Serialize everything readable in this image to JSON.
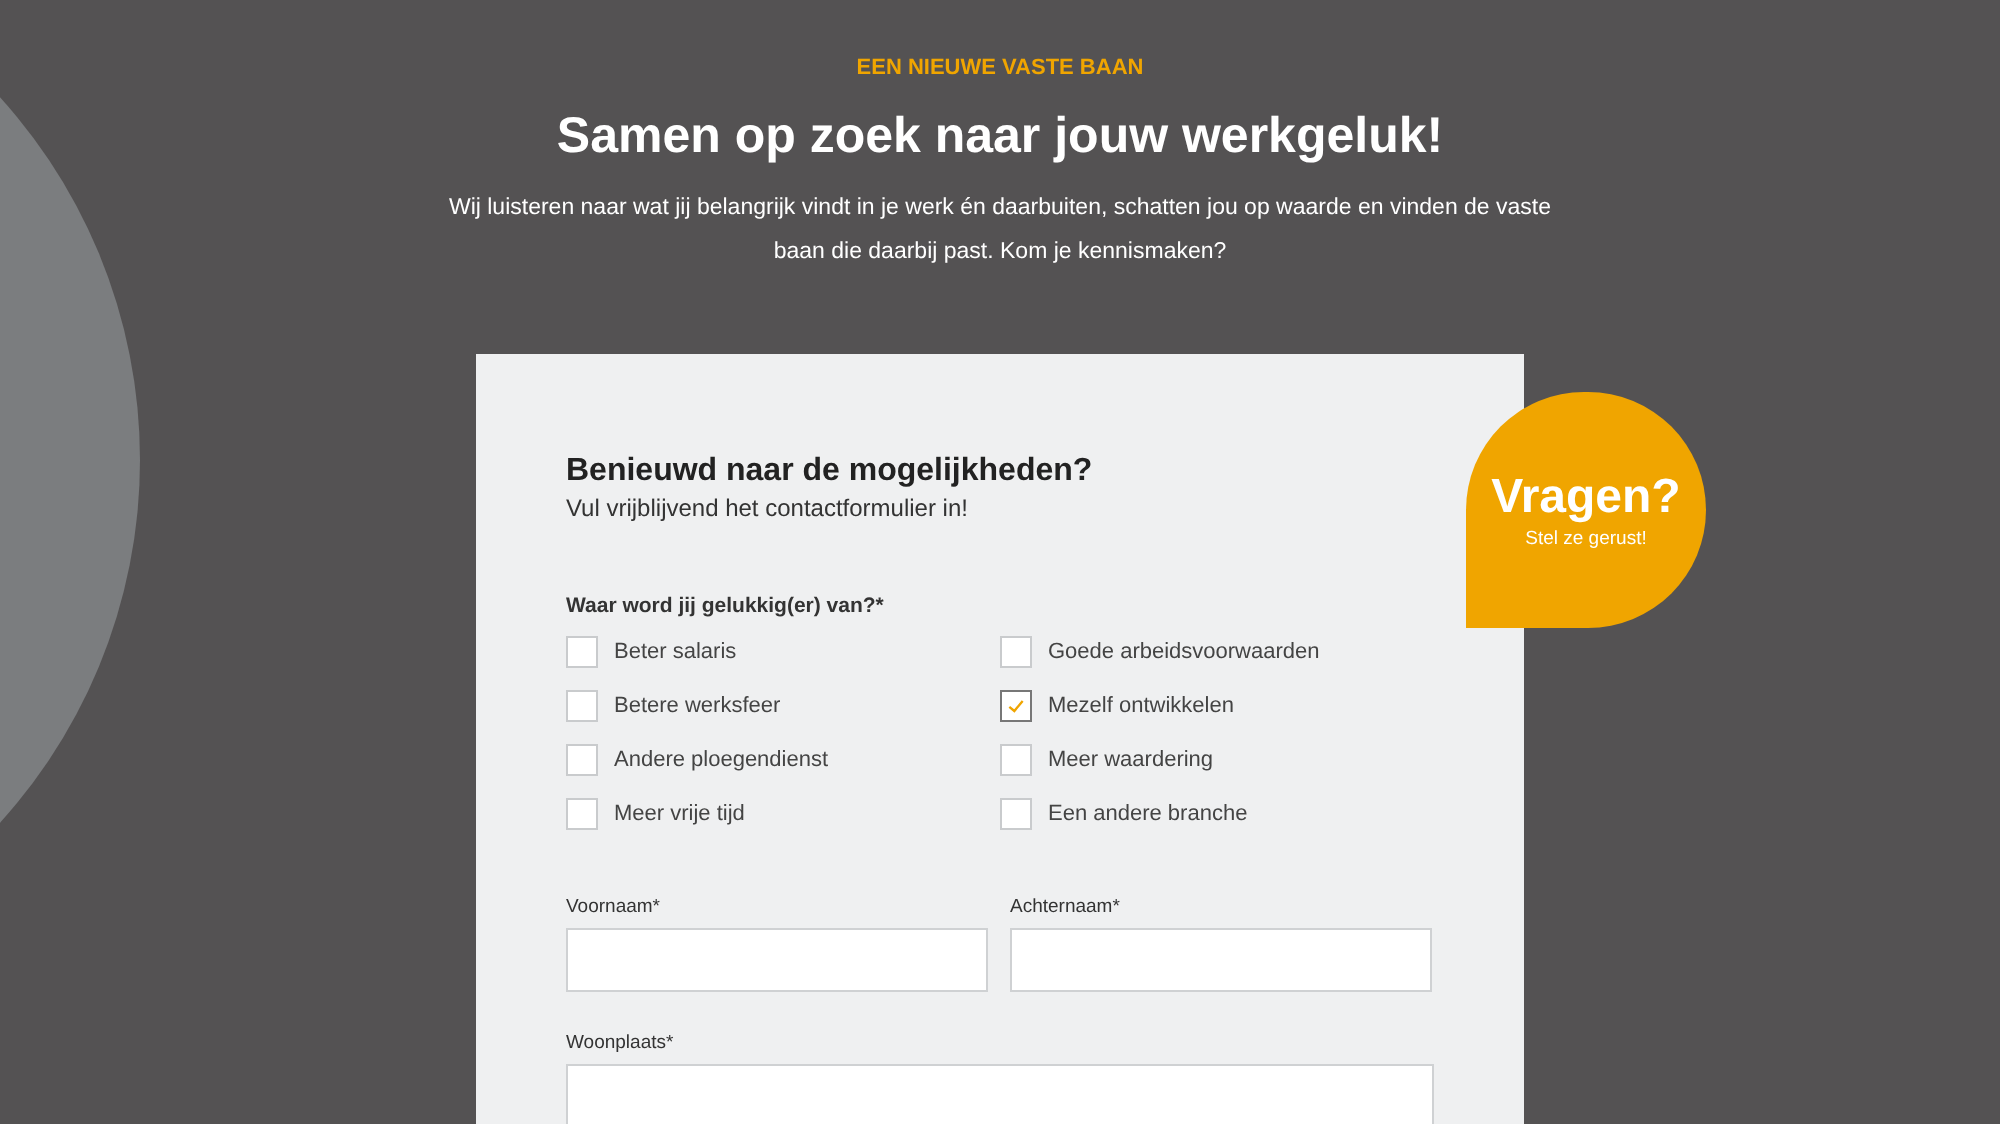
{
  "hero": {
    "eyebrow": "EEN NIEUWE VASTE BAAN",
    "title": "Samen op zoek naar jouw werkgeluk!",
    "intro": "Wij luisteren naar wat jij belangrijk vindt in je werk én daarbuiten, schatten jou op waarde en vinden de vaste baan die daarbij past. Kom je kennismaken?"
  },
  "form": {
    "title": "Benieuwd naar de mogelijkheden?",
    "subtitle": "Vul vrijblijvend het contactformulier in!",
    "question": "Waar word jij gelukkig(er) van?*",
    "options": [
      {
        "label": "Beter salaris",
        "checked": false
      },
      {
        "label": "Goede arbeidsvoorwaarden",
        "checked": false
      },
      {
        "label": "Betere werksfeer",
        "checked": false
      },
      {
        "label": "Mezelf ontwikkelen",
        "checked": true
      },
      {
        "label": "Andere ploegendienst",
        "checked": false
      },
      {
        "label": "Meer waardering",
        "checked": false
      },
      {
        "label": "Meer vrije tijd",
        "checked": false
      },
      {
        "label": "Een andere branche",
        "checked": false
      }
    ],
    "fields": [
      {
        "label": "Voornaam*",
        "kind": "half"
      },
      {
        "label": "Achternaam*",
        "kind": "half"
      },
      {
        "label": "Woonplaats*",
        "kind": "full"
      }
    ]
  },
  "badge": {
    "title": "Vragen?",
    "subtitle": "Stel ze gerust!"
  }
}
